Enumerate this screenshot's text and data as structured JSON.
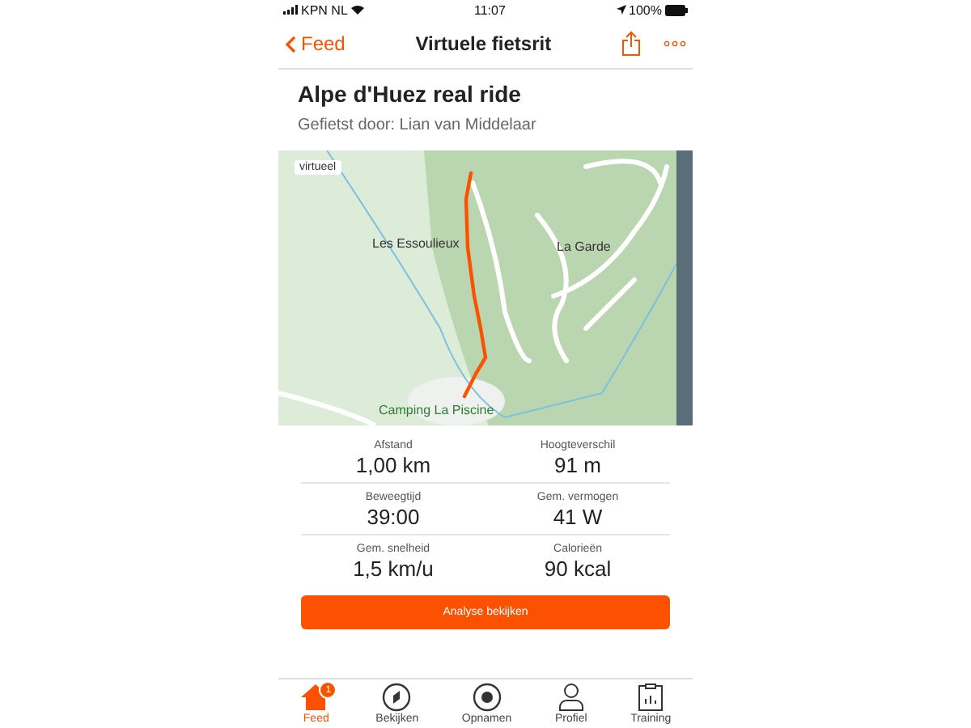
{
  "status_bar": {
    "carrier": "KPN NL",
    "time": "11:07",
    "battery": "100%"
  },
  "nav": {
    "back": "Feed",
    "title": "Virtuele fietsrit"
  },
  "activity": {
    "title": "Alpe d'Huez real ride",
    "subtitle": "Gefietst door: Lian van Middelaar"
  },
  "map": {
    "badge": "virtueel",
    "labels": [
      "Les Essoulieux",
      "La Garde",
      "Camping La Piscine"
    ]
  },
  "stats": [
    {
      "label": "Afstand",
      "value": "1,00 km"
    },
    {
      "label": "Hoogteverschil",
      "value": "91 m"
    },
    {
      "label": "Beweegtijd",
      "value": "39:00"
    },
    {
      "label": "Gem. vermogen",
      "value": "41 W"
    },
    {
      "label": "Gem. snelheid",
      "value": "1,5 km/u"
    },
    {
      "label": "Calorieën",
      "value": "90 kcal"
    }
  ],
  "action_button": "Analyse bekijken",
  "tab_bar": [
    {
      "kind": "home",
      "label": "Feed",
      "selected": true,
      "badge": "1"
    },
    {
      "kind": "compass",
      "label": "Bekijken",
      "selected": false
    },
    {
      "kind": "record",
      "label": "Opnamen",
      "selected": false
    },
    {
      "kind": "person",
      "label": "Profiel",
      "selected": false
    },
    {
      "kind": "clipboard",
      "label": "Training",
      "selected": false
    }
  ]
}
